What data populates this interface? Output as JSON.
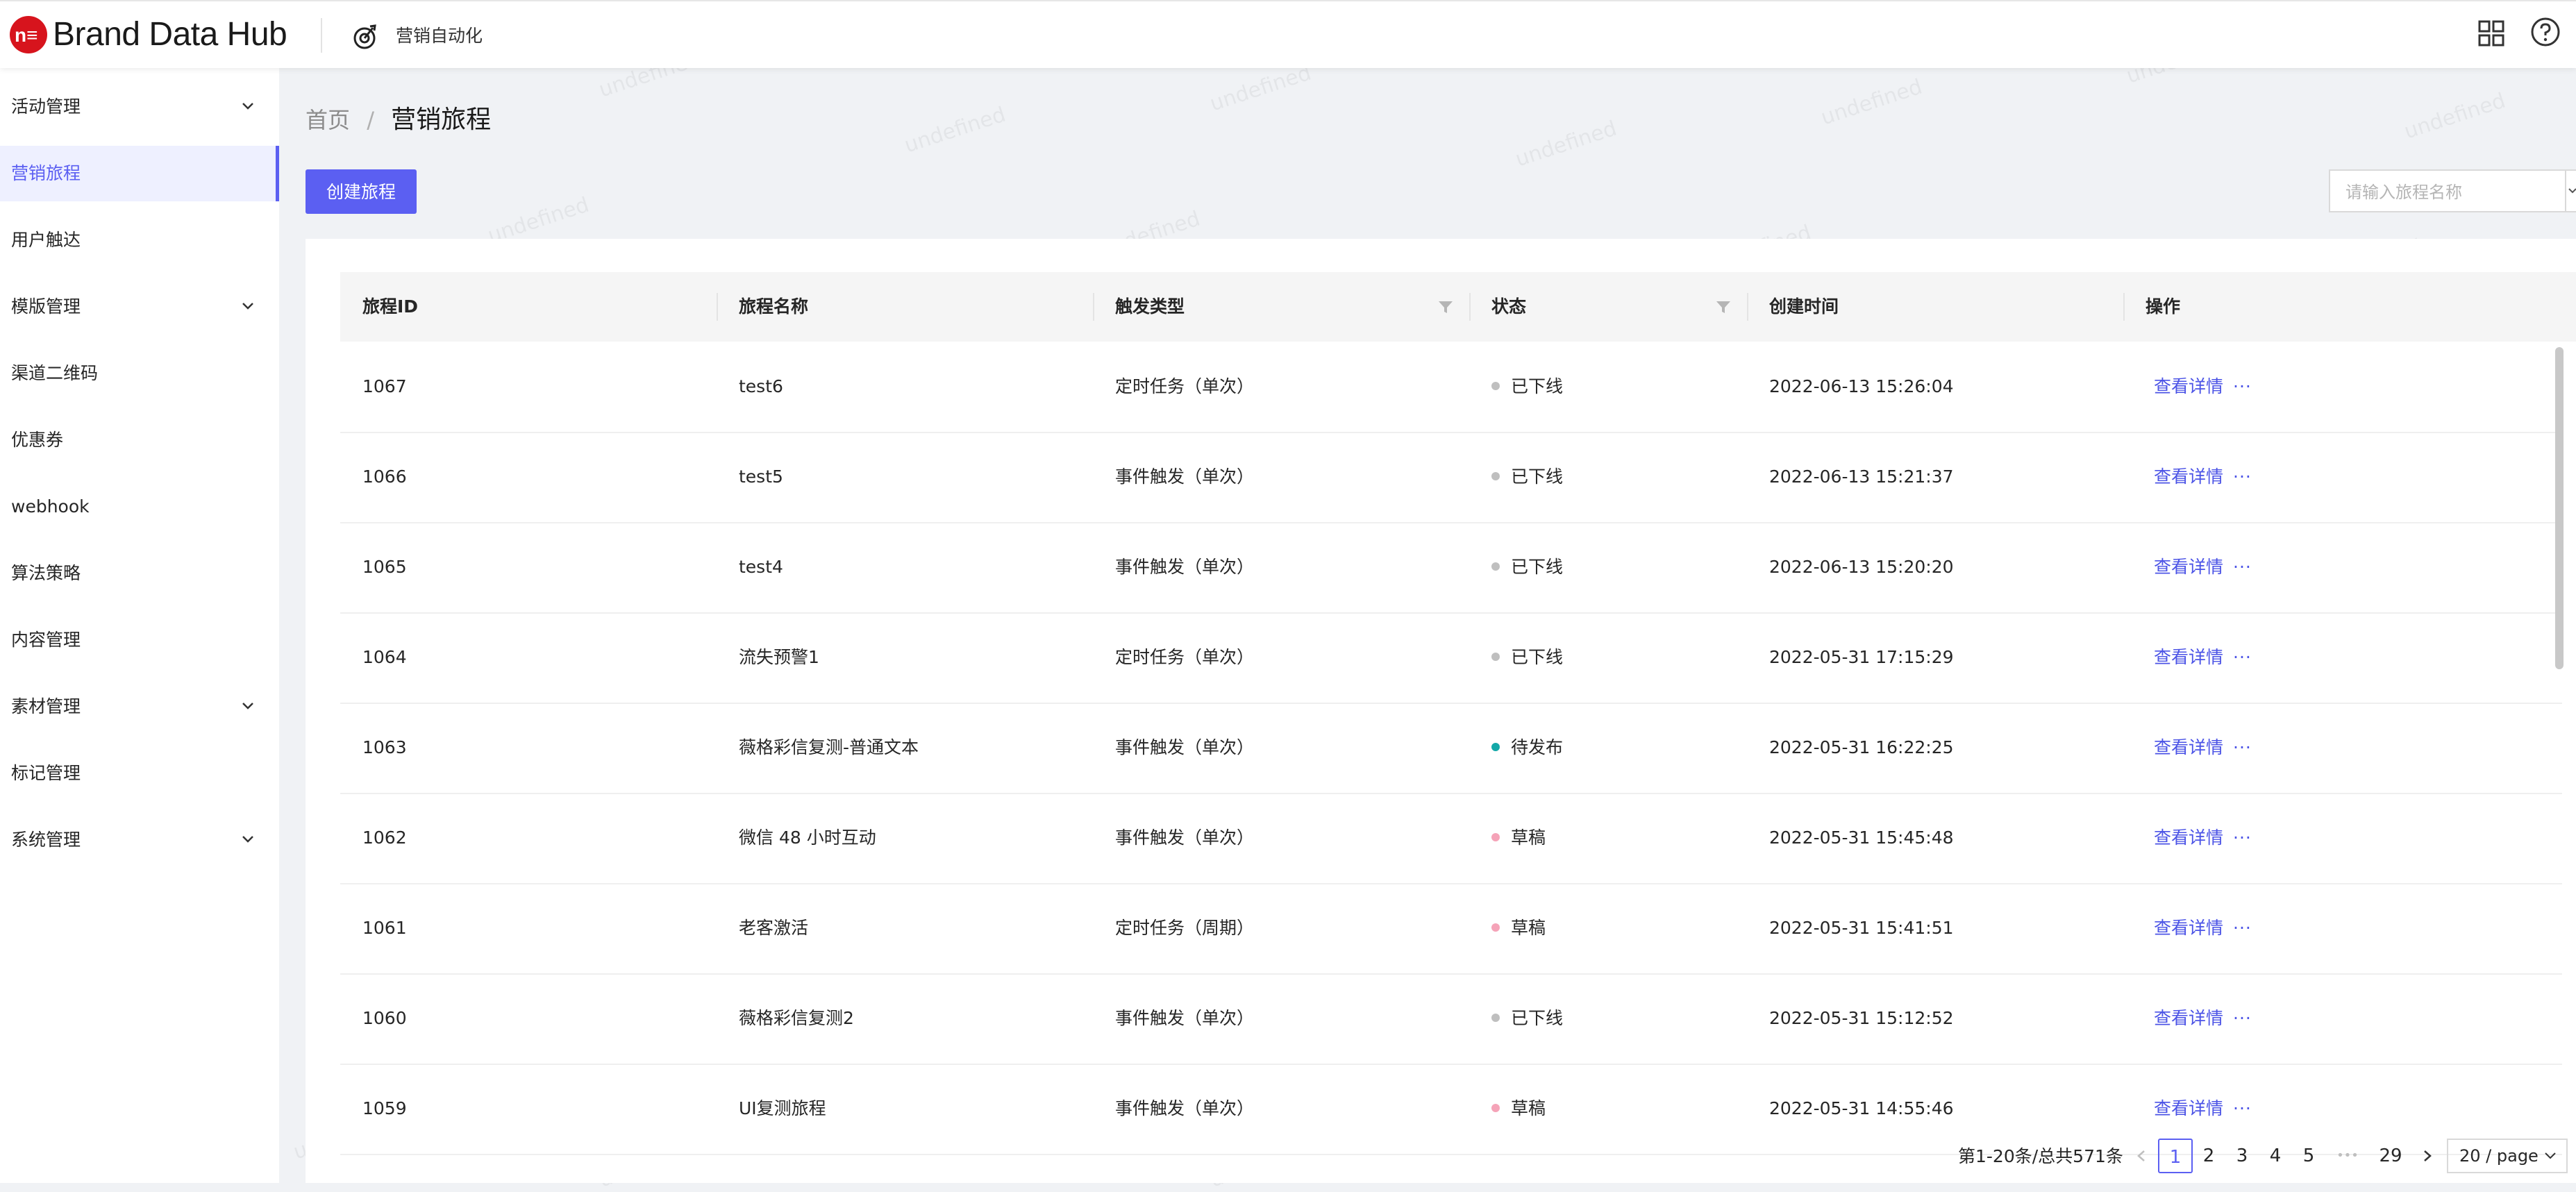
{
  "header": {
    "logo_mark": "n≡",
    "brand": "Brand Data Hub",
    "module_title": "营销自动化",
    "apps_icon": "grid-icon",
    "help_icon": "question-circle-icon"
  },
  "sidebar": {
    "items": [
      {
        "label": "活动管理",
        "expandable": true
      },
      {
        "label": "营销旅程",
        "active": true
      },
      {
        "label": "用户触达"
      },
      {
        "label": "模版管理",
        "expandable": true
      },
      {
        "label": "渠道二维码"
      },
      {
        "label": "优惠券"
      },
      {
        "label": "webhook"
      },
      {
        "label": "算法策略"
      },
      {
        "label": "内容管理"
      },
      {
        "label": "素材管理",
        "expandable": true
      },
      {
        "label": "标记管理"
      },
      {
        "label": "系统管理",
        "expandable": true
      }
    ]
  },
  "breadcrumb": {
    "home": "首页",
    "separator": "/",
    "current": "营销旅程"
  },
  "toolbar": {
    "create_label": "创建旅程",
    "search_placeholder": "请输入旅程名称"
  },
  "table": {
    "columns": [
      "旅程ID",
      "旅程名称",
      "触发类型",
      "状态",
      "创建时间",
      "操作"
    ],
    "action_label": "查看详情",
    "more_label": "···",
    "rows": [
      {
        "id": "1067",
        "name": "test6",
        "trigger": "定时任务（单次）",
        "status": "已下线",
        "status_color": "#bfbfbf",
        "created": "2022-06-13 15:26:04"
      },
      {
        "id": "1066",
        "name": "test5",
        "trigger": "事件触发（单次）",
        "status": "已下线",
        "status_color": "#bfbfbf",
        "created": "2022-06-13 15:21:37"
      },
      {
        "id": "1065",
        "name": "test4",
        "trigger": "事件触发（单次）",
        "status": "已下线",
        "status_color": "#bfbfbf",
        "created": "2022-06-13 15:20:20"
      },
      {
        "id": "1064",
        "name": "流失预警1",
        "trigger": "定时任务（单次）",
        "status": "已下线",
        "status_color": "#bfbfbf",
        "created": "2022-05-31 17:15:29"
      },
      {
        "id": "1063",
        "name": "薇格彩信复测-普通文本",
        "trigger": "事件触发（单次）",
        "status": "待发布",
        "status_color": "#13a8a8",
        "created": "2022-05-31 16:22:25"
      },
      {
        "id": "1062",
        "name": "微信 48 小时互动",
        "trigger": "事件触发（单次）",
        "status": "草稿",
        "status_color": "#f5a3b8",
        "created": "2022-05-31 15:45:48"
      },
      {
        "id": "1061",
        "name": "老客激活",
        "trigger": "定时任务（周期）",
        "status": "草稿",
        "status_color": "#f5a3b8",
        "created": "2022-05-31 15:41:51"
      },
      {
        "id": "1060",
        "name": "薇格彩信复测2",
        "trigger": "事件触发（单次）",
        "status": "已下线",
        "status_color": "#bfbfbf",
        "created": "2022-05-31 15:12:52"
      },
      {
        "id": "1059",
        "name": "UI复测旅程",
        "trigger": "事件触发（单次）",
        "status": "草稿",
        "status_color": "#f5a3b8",
        "created": "2022-05-31 14:55:46"
      }
    ]
  },
  "pagination": {
    "total_text": "第1-20条/总共571条",
    "pages": [
      "1",
      "2",
      "3",
      "4",
      "5"
    ],
    "ellipsis": "•••",
    "last_page": "29",
    "current": "1",
    "page_size": "20 / page"
  },
  "watermark_text": "undefined",
  "colors": {
    "accent": "#5b5ff2",
    "link": "#4b53e6",
    "brand_red": "#d7141d"
  }
}
